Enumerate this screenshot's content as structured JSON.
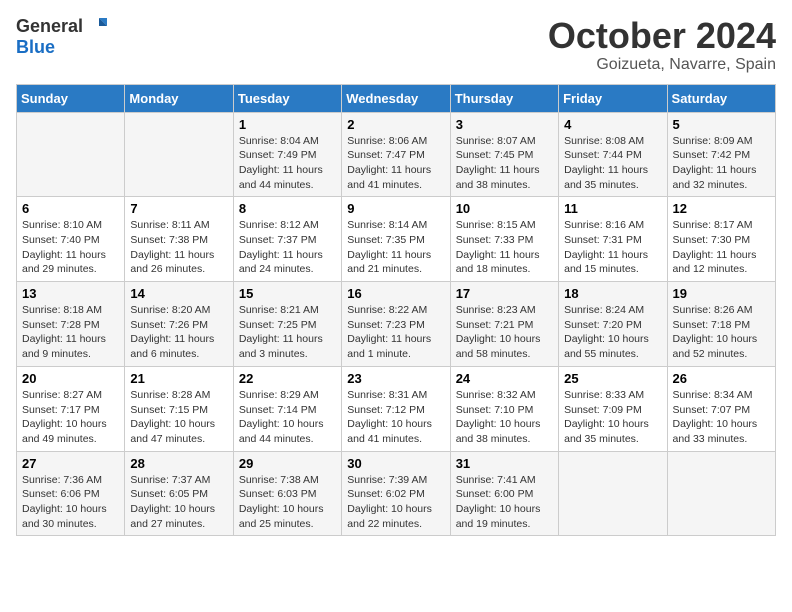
{
  "header": {
    "logo_line1": "General",
    "logo_line2": "Blue",
    "title": "October 2024",
    "subtitle": "Goizueta, Navarre, Spain"
  },
  "weekdays": [
    "Sunday",
    "Monday",
    "Tuesday",
    "Wednesday",
    "Thursday",
    "Friday",
    "Saturday"
  ],
  "weeks": [
    [
      {
        "day": "",
        "info": ""
      },
      {
        "day": "",
        "info": ""
      },
      {
        "day": "1",
        "info": "Sunrise: 8:04 AM\nSunset: 7:49 PM\nDaylight: 11 hours and 44 minutes."
      },
      {
        "day": "2",
        "info": "Sunrise: 8:06 AM\nSunset: 7:47 PM\nDaylight: 11 hours and 41 minutes."
      },
      {
        "day": "3",
        "info": "Sunrise: 8:07 AM\nSunset: 7:45 PM\nDaylight: 11 hours and 38 minutes."
      },
      {
        "day": "4",
        "info": "Sunrise: 8:08 AM\nSunset: 7:44 PM\nDaylight: 11 hours and 35 minutes."
      },
      {
        "day": "5",
        "info": "Sunrise: 8:09 AM\nSunset: 7:42 PM\nDaylight: 11 hours and 32 minutes."
      }
    ],
    [
      {
        "day": "6",
        "info": "Sunrise: 8:10 AM\nSunset: 7:40 PM\nDaylight: 11 hours and 29 minutes."
      },
      {
        "day": "7",
        "info": "Sunrise: 8:11 AM\nSunset: 7:38 PM\nDaylight: 11 hours and 26 minutes."
      },
      {
        "day": "8",
        "info": "Sunrise: 8:12 AM\nSunset: 7:37 PM\nDaylight: 11 hours and 24 minutes."
      },
      {
        "day": "9",
        "info": "Sunrise: 8:14 AM\nSunset: 7:35 PM\nDaylight: 11 hours and 21 minutes."
      },
      {
        "day": "10",
        "info": "Sunrise: 8:15 AM\nSunset: 7:33 PM\nDaylight: 11 hours and 18 minutes."
      },
      {
        "day": "11",
        "info": "Sunrise: 8:16 AM\nSunset: 7:31 PM\nDaylight: 11 hours and 15 minutes."
      },
      {
        "day": "12",
        "info": "Sunrise: 8:17 AM\nSunset: 7:30 PM\nDaylight: 11 hours and 12 minutes."
      }
    ],
    [
      {
        "day": "13",
        "info": "Sunrise: 8:18 AM\nSunset: 7:28 PM\nDaylight: 11 hours and 9 minutes."
      },
      {
        "day": "14",
        "info": "Sunrise: 8:20 AM\nSunset: 7:26 PM\nDaylight: 11 hours and 6 minutes."
      },
      {
        "day": "15",
        "info": "Sunrise: 8:21 AM\nSunset: 7:25 PM\nDaylight: 11 hours and 3 minutes."
      },
      {
        "day": "16",
        "info": "Sunrise: 8:22 AM\nSunset: 7:23 PM\nDaylight: 11 hours and 1 minute."
      },
      {
        "day": "17",
        "info": "Sunrise: 8:23 AM\nSunset: 7:21 PM\nDaylight: 10 hours and 58 minutes."
      },
      {
        "day": "18",
        "info": "Sunrise: 8:24 AM\nSunset: 7:20 PM\nDaylight: 10 hours and 55 minutes."
      },
      {
        "day": "19",
        "info": "Sunrise: 8:26 AM\nSunset: 7:18 PM\nDaylight: 10 hours and 52 minutes."
      }
    ],
    [
      {
        "day": "20",
        "info": "Sunrise: 8:27 AM\nSunset: 7:17 PM\nDaylight: 10 hours and 49 minutes."
      },
      {
        "day": "21",
        "info": "Sunrise: 8:28 AM\nSunset: 7:15 PM\nDaylight: 10 hours and 47 minutes."
      },
      {
        "day": "22",
        "info": "Sunrise: 8:29 AM\nSunset: 7:14 PM\nDaylight: 10 hours and 44 minutes."
      },
      {
        "day": "23",
        "info": "Sunrise: 8:31 AM\nSunset: 7:12 PM\nDaylight: 10 hours and 41 minutes."
      },
      {
        "day": "24",
        "info": "Sunrise: 8:32 AM\nSunset: 7:10 PM\nDaylight: 10 hours and 38 minutes."
      },
      {
        "day": "25",
        "info": "Sunrise: 8:33 AM\nSunset: 7:09 PM\nDaylight: 10 hours and 35 minutes."
      },
      {
        "day": "26",
        "info": "Sunrise: 8:34 AM\nSunset: 7:07 PM\nDaylight: 10 hours and 33 minutes."
      }
    ],
    [
      {
        "day": "27",
        "info": "Sunrise: 7:36 AM\nSunset: 6:06 PM\nDaylight: 10 hours and 30 minutes."
      },
      {
        "day": "28",
        "info": "Sunrise: 7:37 AM\nSunset: 6:05 PM\nDaylight: 10 hours and 27 minutes."
      },
      {
        "day": "29",
        "info": "Sunrise: 7:38 AM\nSunset: 6:03 PM\nDaylight: 10 hours and 25 minutes."
      },
      {
        "day": "30",
        "info": "Sunrise: 7:39 AM\nSunset: 6:02 PM\nDaylight: 10 hours and 22 minutes."
      },
      {
        "day": "31",
        "info": "Sunrise: 7:41 AM\nSunset: 6:00 PM\nDaylight: 10 hours and 19 minutes."
      },
      {
        "day": "",
        "info": ""
      },
      {
        "day": "",
        "info": ""
      }
    ]
  ]
}
